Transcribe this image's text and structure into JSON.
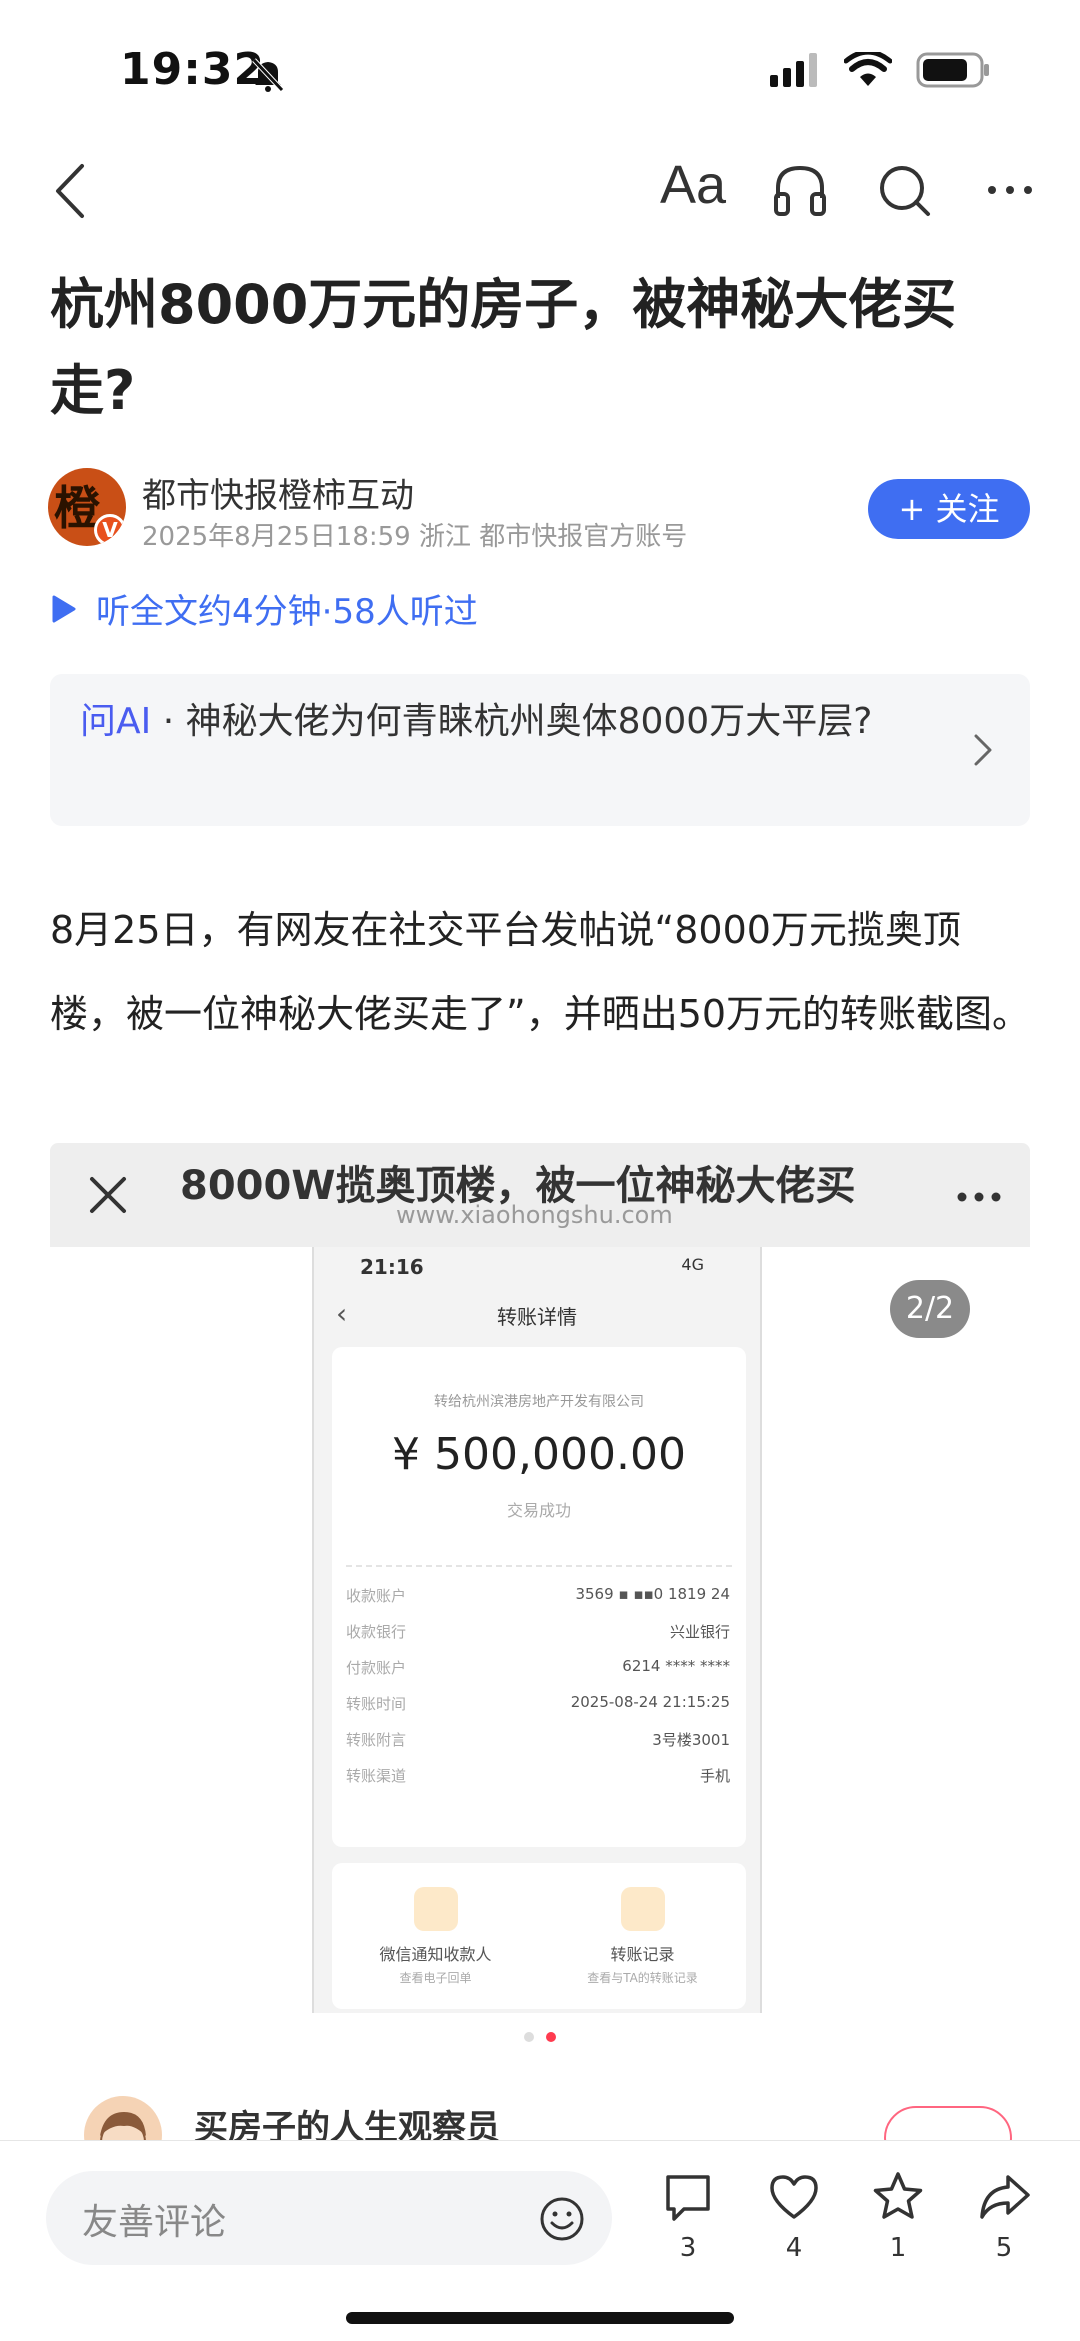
{
  "status_bar": {
    "time": "19:32"
  },
  "nav": {
    "font_label": "Aa"
  },
  "article": {
    "title": "杭州8000万元的房子，被神秘大佬买走?",
    "author": {
      "name": "都市快报橙柿互动",
      "meta": "2025年8月25日18:59 浙江 都市快报官方账号",
      "avatar_glyph": "橙",
      "avatar_badge": "V"
    },
    "follow_label": "+ 关注",
    "listen_label": "听全文约4分钟·58人听过",
    "ask_ai": {
      "label": "问AI",
      "separator": " · ",
      "question": "神秘大佬为何青睐杭州奥体8000万大平层?"
    },
    "paragraph": "8月25日，有网友在社交平台发帖说“8000万元揽奥顶楼，被一位神秘大佬买走了”，并晒出50万元的转账截图。"
  },
  "embed": {
    "title": "8000W揽奥顶楼，被一位神秘大佬买",
    "url": "www.xiaohongshu.com",
    "page_badge": "2/2",
    "phone": {
      "time": "21:16",
      "signal": "4G",
      "screen_title": "转账详情",
      "payee": "转给杭州滨港房地产开发有限公司",
      "amount": "¥ 500,000.00",
      "status": "交易成功",
      "rows": [
        {
          "label": "收款账户",
          "value": "3569 ▪ ▪▪0 1819 24"
        },
        {
          "label": "收款银行",
          "value": "兴业银行"
        },
        {
          "label": "付款账户",
          "value": "6214 **** ****"
        },
        {
          "label": "转账时间",
          "value": "2025-08-24 21:15:25"
        },
        {
          "label": "转账附言",
          "value": "3号楼3001"
        },
        {
          "label": "转账渠道",
          "value": "手机"
        }
      ],
      "actions": [
        {
          "label": "微信通知收款人",
          "sub": "查看电子回单"
        },
        {
          "label": "转账记录",
          "sub": "查看与TA的转账记录"
        }
      ]
    }
  },
  "next_author": {
    "name": "买房子的人生观察员"
  },
  "bottom_bar": {
    "comment_placeholder": "友善评论",
    "comments": "3",
    "likes": "4",
    "favorites": "1",
    "shares": "5"
  },
  "colors": {
    "accent": "#3f6ef2",
    "ai_label": "#4a5cf0",
    "page_bg": "#ffffff"
  }
}
